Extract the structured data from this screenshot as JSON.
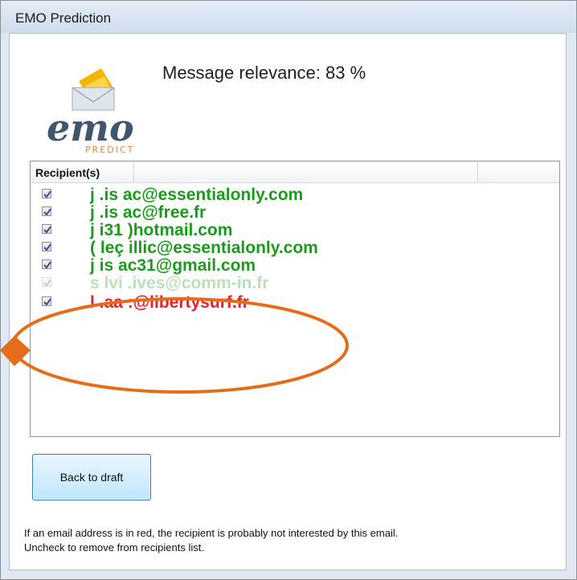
{
  "window": {
    "title": "EMO Prediction"
  },
  "logo": {
    "wordmark": "emo",
    "tagline": "PREDICT"
  },
  "relevance": {
    "text": "Message relevance: 83 %"
  },
  "recipients": {
    "header": "Recipient(s)",
    "items": [
      {
        "email": "j .is ac@essentialonly.com",
        "checked": true,
        "status": "interested",
        "color": "#1c9a1c"
      },
      {
        "email": "j .is ac@free.fr",
        "checked": true,
        "status": "interested",
        "color": "#1c9a1c"
      },
      {
        "email": "j i31 )hotmail.com",
        "checked": true,
        "status": "interested",
        "color": "#1c9a1c"
      },
      {
        "email": "( leç illic@essentialonly.com",
        "checked": true,
        "status": "interested",
        "color": "#1c9a1c"
      },
      {
        "email": "j is ac31@gmail.com",
        "checked": true,
        "status": "interested",
        "color": "#1c9a1c"
      },
      {
        "email": "s lvi .ives@comm-in.fr",
        "checked": true,
        "status": "faded",
        "color": "#1c9a1c"
      },
      {
        "email": "l .aa :@libertysurf.fr",
        "checked": true,
        "status": "not-interested",
        "color": "#e8202a"
      }
    ]
  },
  "buttons": {
    "back": "Back to draft"
  },
  "hint": {
    "line1": "If an email address is in red, the recipient is probably not interested by this email.",
    "line2": "Uncheck to remove from recipients list."
  },
  "colors": {
    "annotation": "#e46c1b",
    "interested": "#1c9a1c",
    "not_interested": "#e8202a"
  }
}
